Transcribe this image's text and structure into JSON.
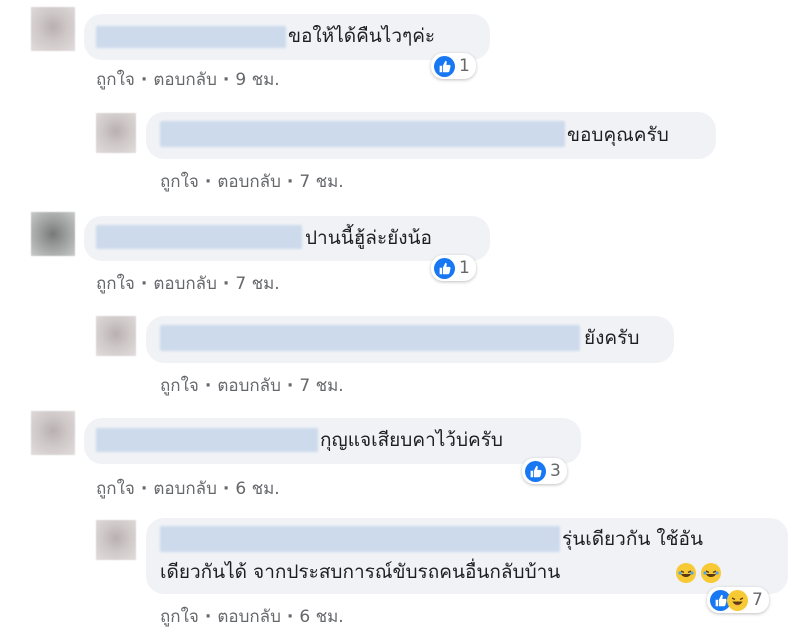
{
  "comments": [
    {
      "text": "ขอให้ได้คืนไวๆค่ะ",
      "like": "ถูกใจ",
      "reply": "ตอบกลับ",
      "time": "9 ชม.",
      "reactions": "1"
    },
    {
      "text": "ขอบคุณครับ",
      "like": "ถูกใจ",
      "reply": "ตอบกลับ",
      "time": "7 ชม."
    },
    {
      "text": "ปานนี้ฮู้ล่ะยังน้อ",
      "like": "ถูกใจ",
      "reply": "ตอบกลับ",
      "time": "7 ชม.",
      "reactions": "1"
    },
    {
      "text": "ยังครับ",
      "like": "ถูกใจ",
      "reply": "ตอบกลับ",
      "time": "7 ชม."
    },
    {
      "text": "กุญแจเสียบคาไว้บ่ครับ",
      "like": "ถูกใจ",
      "reply": "ตอบกลับ",
      "time": "6 ชม.",
      "reactions": "3"
    },
    {
      "text_line1": "รุ่นเดียวกัน ใช้อัน",
      "text_line2": "เดียวกันได้ จากประสบการณ์ขับรถคนอื่นกลับบ้าน",
      "like": "ถูกใจ",
      "reply": "ตอบกลับ",
      "time": "6 ชม.",
      "reactions": "7"
    }
  ],
  "colors": {
    "like_blue": "#1877f2",
    "bubble_bg": "#f0f2f5",
    "meta_grey": "#65676b",
    "redaction": "#ccd9ec"
  },
  "icons": [
    "like-icon",
    "haha-icon",
    "laughing-emoji"
  ]
}
